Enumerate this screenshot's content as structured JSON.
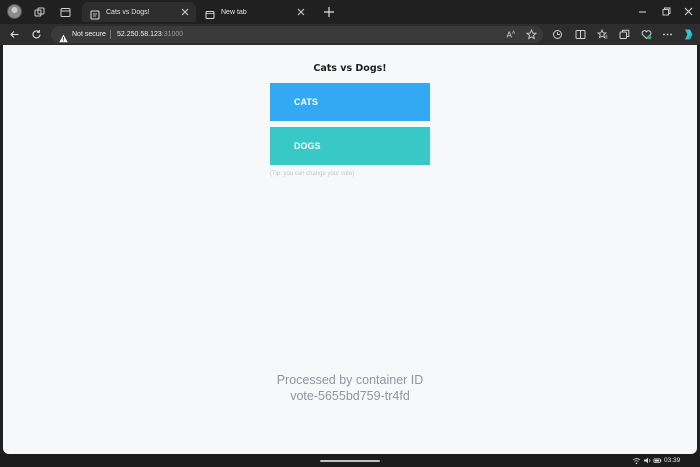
{
  "browser": {
    "tabs": [
      {
        "title": "Cats vs Dogs!",
        "active": true
      },
      {
        "title": "New tab",
        "active": false
      }
    ],
    "address": {
      "security_label": "Not secure",
      "host": "52.250.58.123",
      "port": ":31000"
    }
  },
  "page": {
    "heading": "Cats vs Dogs!",
    "options": [
      {
        "label": "CATS",
        "color": "#34a9f3"
      },
      {
        "label": "DOGS",
        "color": "#38c9c6"
      }
    ],
    "tip": "(Tip: you can change your vote)",
    "footer_line1": "Processed by container ID",
    "footer_line2": "vote-5655bd759-tr4fd"
  },
  "taskbar": {
    "time": "03:39"
  },
  "icons": {
    "tabstrip": [
      "avatar",
      "collections-icon",
      "tab-actions-icon"
    ],
    "toolbar": [
      "back-icon",
      "refresh-icon",
      "warning-icon",
      "read-aloud-icon",
      "favorite-star-icon",
      "browser-essentials-icon",
      "split-screen-icon",
      "favorites-icon",
      "collections-icon",
      "heart-icon",
      "more-icon",
      "copilot-icon"
    ],
    "tray": [
      "wifi-icon",
      "volume-icon",
      "battery-icon"
    ]
  },
  "colors": {
    "cats_button": "#34a9f3",
    "dogs_button": "#38c9c6",
    "page_background": "#f7f8f9",
    "browser_frame": "#202020"
  }
}
